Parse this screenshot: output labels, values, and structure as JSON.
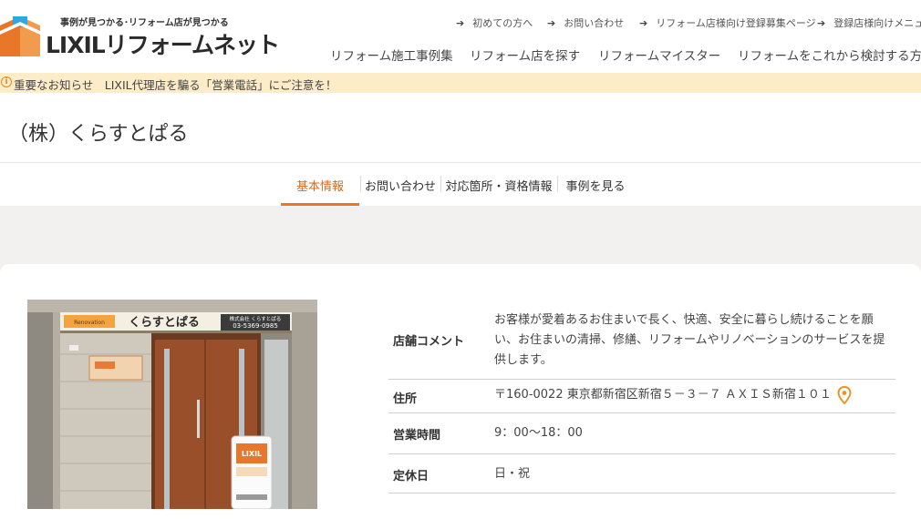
{
  "header": {
    "tagline": "事例が見つかる･リフォーム店が見つかる",
    "brand": "LIXILリフォームネット",
    "utility_links": [
      {
        "label": "初めての方へ"
      },
      {
        "label": "お問い合わせ"
      },
      {
        "label": "リフォーム店様向け登録募集ページ"
      },
      {
        "label": "登録店様向けメニュー"
      }
    ],
    "main_nav": [
      {
        "label": "リフォーム施工事例集"
      },
      {
        "label": "リフォーム店を探す"
      },
      {
        "label": "リフォームマイスター"
      },
      {
        "label": "リフォームをこれから検討する方へ"
      }
    ]
  },
  "notice": {
    "text": "重要なお知らせ　LIXIL代理店を騙る「営業電話」にご注意を！"
  },
  "page": {
    "title": "（株）くらすとぱる"
  },
  "tabs": [
    {
      "label": "基本情報",
      "active": true
    },
    {
      "label": "お問い合わせ",
      "active": false
    },
    {
      "label": "対応箇所・資格情報",
      "active": false
    },
    {
      "label": "事例を見る",
      "active": false
    }
  ],
  "photo": {
    "sign_name": "くらすとぱる",
    "sign_phone": "03-5369-0985",
    "sign_company": "株式会社 くらすとぱる",
    "standee_brand": "LIXIL"
  },
  "info": {
    "comment_label": "店舗コメント",
    "comment_value": "お客様が愛着あるお住まいで長く、快適、安全に暮らし続けることを願い、お住まいの清掃、修繕、リフォームやリノベーションのサービスを提供します。",
    "address_label": "住所",
    "address_value": "〒160-0022 東京都新宿区新宿５－３－７ ＡＸＩＳ新宿１０１",
    "hours_label": "営業時間",
    "hours_value": "9：00〜18：00",
    "holiday_label": "定休日",
    "holiday_value": "日・祝"
  },
  "colors": {
    "accent": "#e8772a",
    "notice_bg": "#fcecc7",
    "page_bg": "#f2f1ef"
  },
  "icons": [
    "lixil-logo-icon",
    "arrow-right-icon",
    "info-circle-icon",
    "map-pin-icon"
  ]
}
